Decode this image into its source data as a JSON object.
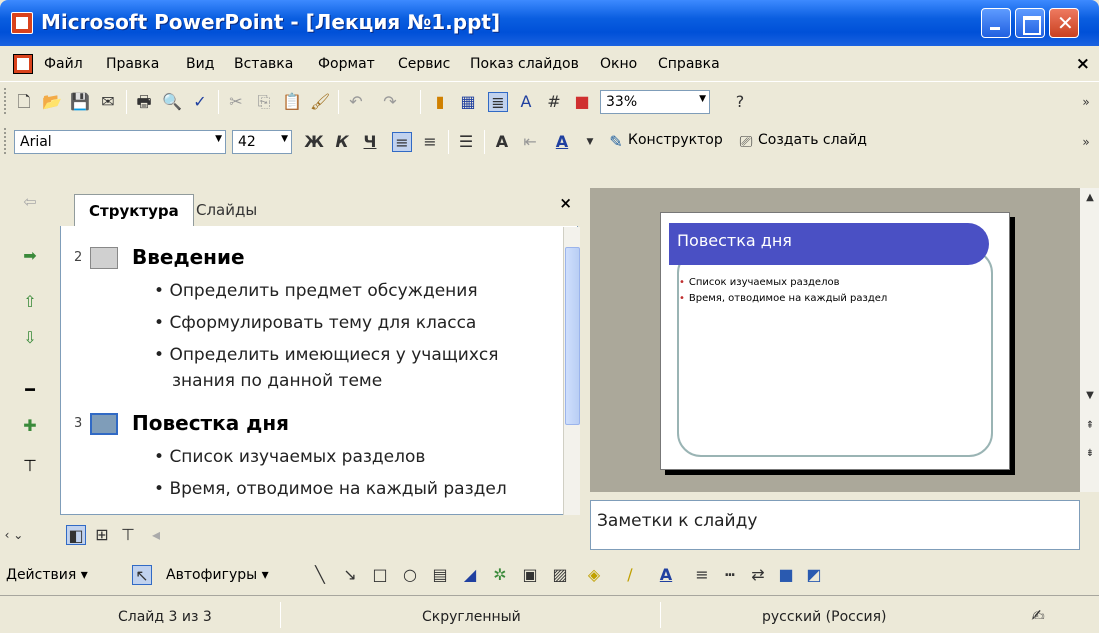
{
  "window": {
    "title": "Microsoft PowerPoint - [Лекция №1.ppt]"
  },
  "menu": [
    "Файл",
    "Правка",
    "Вид",
    "Вставка",
    "Формат",
    "Сервис",
    "Показ слайдов",
    "Окно",
    "Справка"
  ],
  "menu_close": "×",
  "toolbar": {
    "zoom": "33%"
  },
  "format_toolbar": {
    "font": "Arial",
    "size": "42",
    "bold": "Ж",
    "italic": "К",
    "underline": "Ч",
    "designer": "Конструктор",
    "new_slide": "Создать слайд"
  },
  "outline_tabs": {
    "structure": "Структура",
    "slides": "Слайды",
    "close": "×"
  },
  "outline": {
    "slide2": {
      "num": "2",
      "title": "Введение",
      "bullets": [
        "Определить предмет обсуждения",
        "Сформулировать тему для класса",
        "Определить имеющиеся у учащихся",
        "знания по данной теме"
      ]
    },
    "slide3": {
      "num": "3",
      "title": "Повестка дня",
      "bullets": [
        "Список изучаемых разделов",
        "Время, отводимое на каждый раздел"
      ]
    }
  },
  "slide": {
    "title": "Повестка дня",
    "bullets": [
      "Список изучаемых разделов",
      "Время, отводимое на каждый раздел"
    ]
  },
  "notes": {
    "placeholder": "Заметки к слайду"
  },
  "drawing": {
    "actions": "Действия",
    "autoshapes": "Автофигуры"
  },
  "status": {
    "slide": "Слайд 3 из 3",
    "design": "Скругленный",
    "language": "русский (Россия)"
  },
  "colors": {
    "titlebar": "#0a5ee0",
    "slide_title_bar": "#4a50c4",
    "bullet": "#c03030"
  }
}
